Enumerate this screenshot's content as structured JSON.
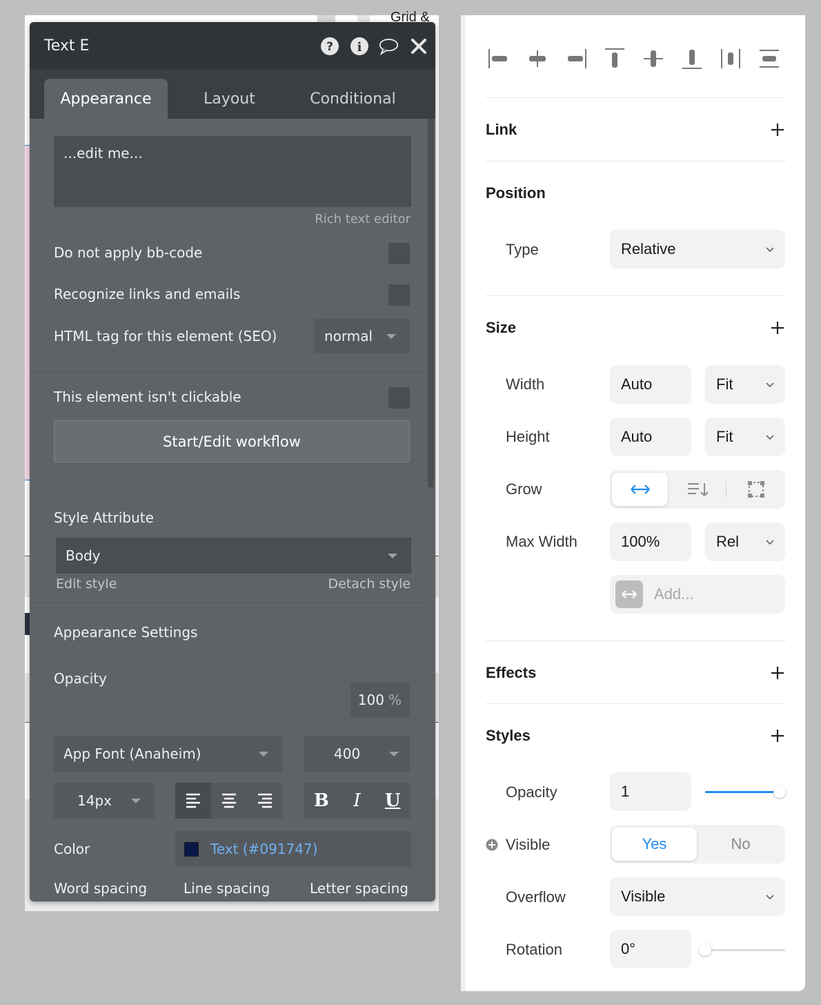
{
  "canvas": {
    "top_text": "Grid &"
  },
  "palette": {
    "title": "Text E",
    "icons": [
      "help-icon",
      "info-icon",
      "comment-icon",
      "close-icon"
    ],
    "tabs": [
      {
        "label": "Appearance",
        "active": true
      },
      {
        "label": "Layout",
        "active": false
      },
      {
        "label": "Conditional",
        "active": false
      }
    ],
    "rich_text_value": "...edit me...",
    "rich_text_hint": "Rich text editor",
    "options": {
      "no_bbcode": "Do not apply bb-code",
      "recognize_links": "Recognize links and emails",
      "html_tag_label": "HTML tag for this element (SEO)",
      "html_tag_value": "normal",
      "not_clickable": "This element isn't clickable"
    },
    "workflow_button": "Start/Edit workflow",
    "style": {
      "label": "Style Attribute",
      "value": "Body",
      "edit": "Edit style",
      "detach": "Detach style"
    },
    "appearance": {
      "heading": "Appearance Settings",
      "opacity_label": "Opacity",
      "opacity_value": "100",
      "opacity_unit": "%",
      "font": "App Font (Anaheim)",
      "weight": "400",
      "size": "14px",
      "bold": "B",
      "italic": "I",
      "underline": "U",
      "color_label": "Color",
      "color_value": "Text (#091747)",
      "color_hex": "#091747",
      "word_spacing": "Word spacing",
      "line_spacing": "Line spacing",
      "letter_spacing": "Letter spacing"
    }
  },
  "panel": {
    "link": "Link",
    "position": {
      "heading": "Position",
      "type_label": "Type",
      "type_value": "Relative"
    },
    "size": {
      "heading": "Size",
      "width_label": "Width",
      "width_value": "Auto",
      "width_mode": "Fit",
      "height_label": "Height",
      "height_value": "Auto",
      "height_mode": "Fit",
      "grow_label": "Grow",
      "max_width_label": "Max Width",
      "max_width_value": "100%",
      "max_width_mode": "Rel",
      "add_placeholder": "Add..."
    },
    "effects": "Effects",
    "styles": {
      "heading": "Styles",
      "opacity_label": "Opacity",
      "opacity_value": "1",
      "opacity_level": 1.0,
      "visible_label": "Visible",
      "visible_yes": "Yes",
      "visible_no": "No",
      "overflow_label": "Overflow",
      "overflow_value": "Visible",
      "rotation_label": "Rotation",
      "rotation_value": "0°",
      "rotation_level": 0.0
    },
    "accent_color": "#1f8ef1"
  }
}
